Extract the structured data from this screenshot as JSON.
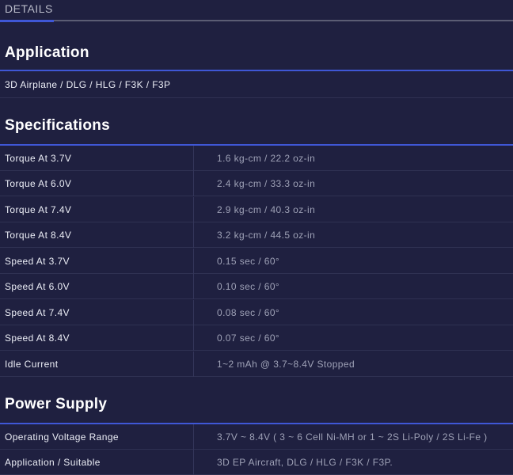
{
  "tab": {
    "label": "DETAILS"
  },
  "application": {
    "title": "Application",
    "value": "3D Airplane / DLG / HLG / F3K / F3P"
  },
  "specifications": {
    "title": "Specifications",
    "rows": [
      {
        "label": "Torque At 3.7V",
        "value": "1.6 kg-cm / 22.2 oz-in"
      },
      {
        "label": "Torque At 6.0V",
        "value": "2.4 kg-cm / 33.3 oz-in"
      },
      {
        "label": "Torque At 7.4V",
        "value": "2.9 kg-cm / 40.3 oz-in"
      },
      {
        "label": "Torque At 8.4V",
        "value": "3.2 kg-cm / 44.5 oz-in"
      },
      {
        "label": "Speed At 3.7V",
        "value": "0.15 sec / 60°"
      },
      {
        "label": "Speed At 6.0V",
        "value": "0.10 sec / 60°"
      },
      {
        "label": "Speed At 7.4V",
        "value": "0.08 sec / 60°"
      },
      {
        "label": "Speed At 8.4V",
        "value": "0.07 sec / 60°"
      },
      {
        "label": "Idle Current",
        "value": "1~2 mAh @ 3.7~8.4V Stopped"
      }
    ]
  },
  "power_supply": {
    "title": "Power Supply",
    "rows": [
      {
        "label": "Operating Voltage Range",
        "value": "3.7V ~ 8.4V ( 3 ~ 6 Cell Ni-MH or 1 ~ 2S Li-Poly / 2S Li-Fe )"
      },
      {
        "label": "Application / Suitable",
        "value": "3D EP Aircraft, DLG / HLG / F3K / F3P."
      }
    ]
  }
}
